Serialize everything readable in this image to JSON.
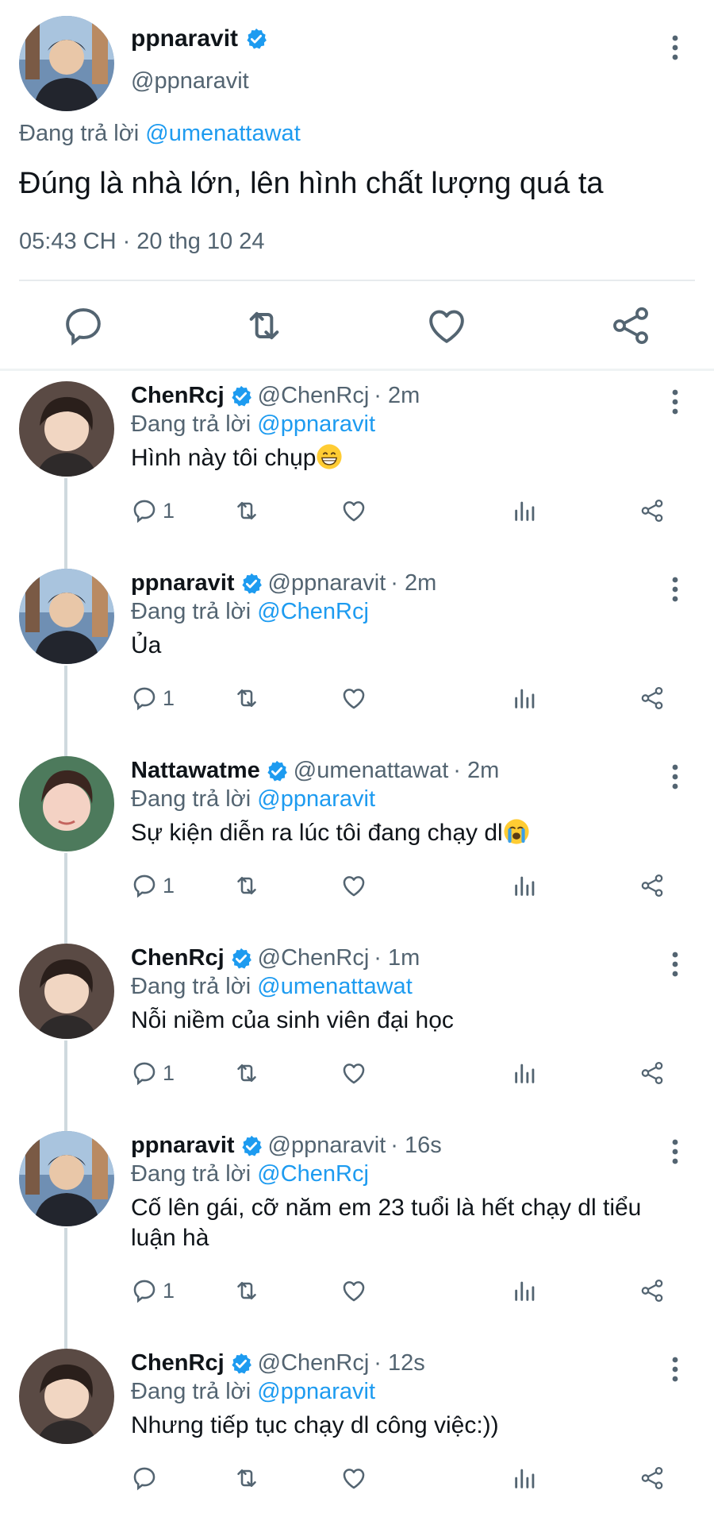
{
  "main_tweet": {
    "name": "ppnaravit",
    "handle": "@ppnaravit",
    "replying_prefix": "Đang trả lời",
    "replying_to": "@umenattawat",
    "text": "Đúng là nhà lớn, lên hình chất lượng quá ta",
    "timestamp": "05:43 CH · 20 thg 10 24"
  },
  "replies": [
    {
      "name": "ChenRcj",
      "handle": "@ChenRcj",
      "time": "· 2m",
      "replying_prefix": "Đang trả lời",
      "replying_to": "@ppnaravit",
      "text": "Hình này tôi chụp",
      "reply_count": "1"
    },
    {
      "name": "ppnaravit",
      "handle": "@ppnaravit",
      "time": "· 2m",
      "replying_prefix": "Đang trả lời",
      "replying_to": "@ChenRcj",
      "text": "Ủa",
      "reply_count": "1"
    },
    {
      "name": "Nattawatme",
      "handle": "@umenattawat",
      "time": "· 2m",
      "replying_prefix": "Đang trả lời",
      "replying_to": "@ppnaravit",
      "text": "Sự kiện diễn ra lúc tôi đang chạy dl",
      "reply_count": "1"
    },
    {
      "name": "ChenRcj",
      "handle": "@ChenRcj",
      "time": "· 1m",
      "replying_prefix": "Đang trả lời",
      "replying_to": "@umenattawat",
      "text": "Nỗi niềm của sinh viên đại học",
      "reply_count": "1"
    },
    {
      "name": "ppnaravit",
      "handle": "@ppnaravit",
      "time": "· 16s",
      "replying_prefix": "Đang trả lời",
      "replying_to": "@ChenRcj",
      "text": "Cố lên gái, cỡ năm em 23 tuổi là hết chạy dl tiểu luận hà",
      "reply_count": "1"
    },
    {
      "name": "ChenRcj",
      "handle": "@ChenRcj",
      "time": "· 12s",
      "replying_prefix": "Đang trả lời",
      "replying_to": "@ppnaravit",
      "text": "Nhưng tiếp tục chạy dl công việc:))",
      "reply_count": ""
    }
  ],
  "colors": {
    "accent": "#1d9bf0",
    "secondary_text": "#536471",
    "primary_text": "#0f1419"
  },
  "icons": [
    "verified-badge-icon",
    "more-icon",
    "reply-icon",
    "retweet-icon",
    "like-icon",
    "share-icon",
    "views-icon",
    "grin-emoji-icon",
    "crying-emoji-icon"
  ]
}
